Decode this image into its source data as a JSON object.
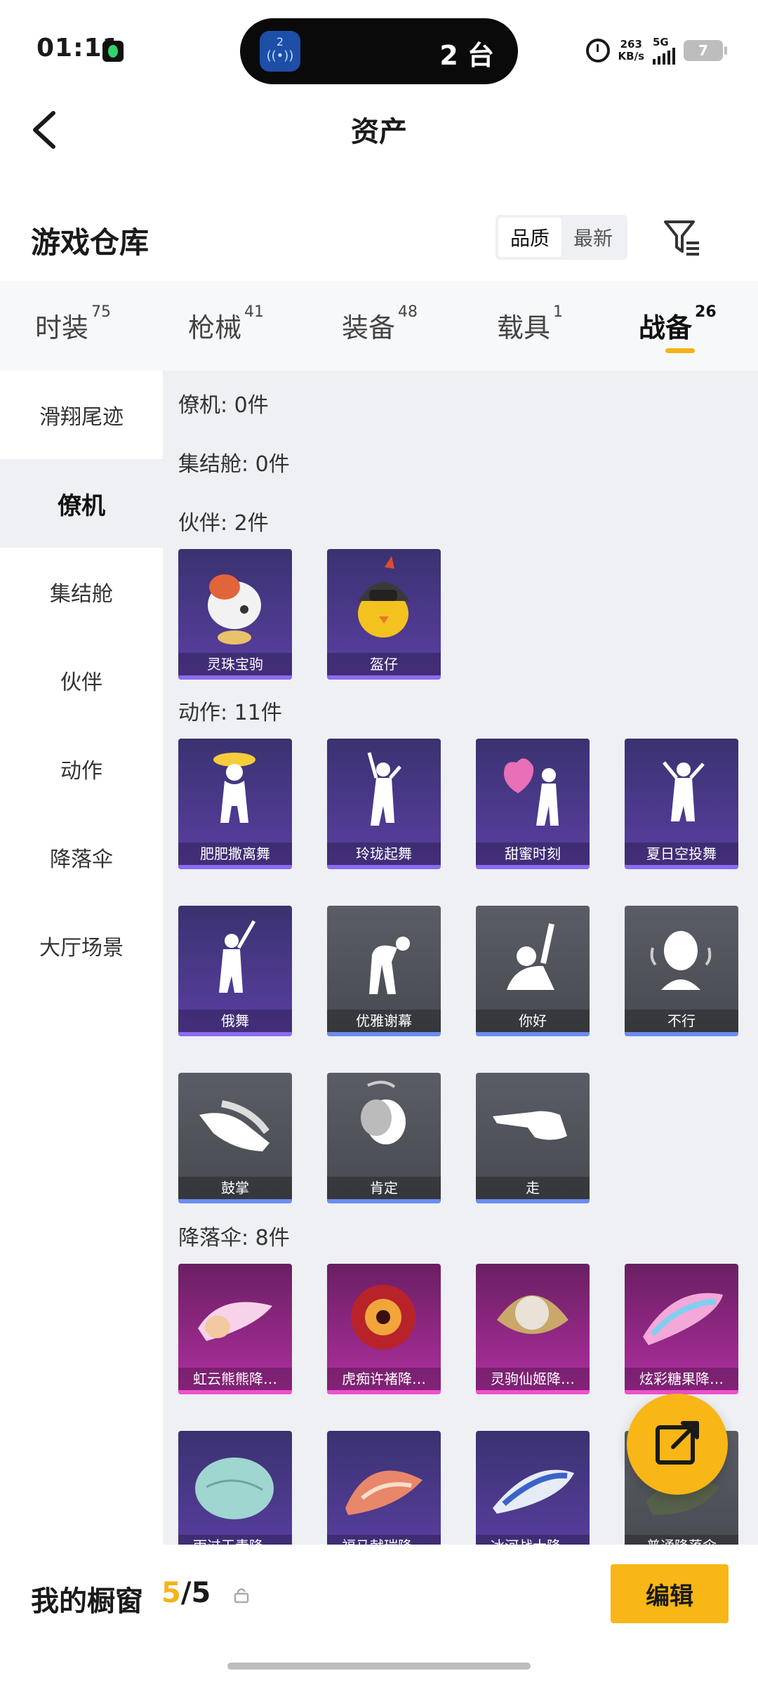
{
  "status_bar": {
    "time": "01:11",
    "island_icon_text": "2",
    "island_text": "2 台",
    "net_speed_value": "263",
    "net_speed_unit": "KB/s",
    "network": "5G",
    "battery": "7"
  },
  "header": {
    "title": "资产"
  },
  "warehouse": {
    "title": "游戏仓库",
    "sort_options": [
      "品质",
      "最新"
    ],
    "active_sort": "品质"
  },
  "tabs": [
    {
      "label": "时装",
      "count": "75"
    },
    {
      "label": "枪械",
      "count": "41"
    },
    {
      "label": "装备",
      "count": "48"
    },
    {
      "label": "载具",
      "count": "1"
    },
    {
      "label": "战备",
      "count": "26",
      "active": true
    }
  ],
  "sidebar": {
    "items": [
      "滑翔尾迹",
      "僚机",
      "集结舱",
      "伙伴",
      "动作",
      "降落伞",
      "大厅场景"
    ],
    "active": "僚机"
  },
  "sections": {
    "wingman": "僚机: 0件",
    "pod": "集结舱: 0件",
    "partner": "伙伴: 2件",
    "emote": "动作: 11件",
    "parachute": "降落伞: 8件"
  },
  "partners": [
    "灵珠宝驹",
    "盔仔"
  ],
  "emotes": [
    "肥肥撒离舞",
    "玲珑起舞",
    "甜蜜时刻",
    "夏日空投舞",
    "俄舞",
    "优雅谢幕",
    "你好",
    "不行",
    "鼓掌",
    "肯定",
    "走"
  ],
  "parachutes": [
    "虹云熊熊降…",
    "虎痴许褚降…",
    "灵驹仙姬降…",
    "炫彩糖果降…",
    "雨过天青降…",
    "福马献瑞降…",
    "冰河战士降…",
    "普通降落伞"
  ],
  "bottom_bar": {
    "title": "我的橱窗",
    "count_current": "5",
    "count_sep": "/",
    "count_total": "5",
    "edit_label": "编辑"
  },
  "colors": {
    "accent": "#f8b617",
    "purple_card": "#4a3a8a",
    "gray_card": "#505259",
    "magenta_card": "#9a2a8c"
  }
}
